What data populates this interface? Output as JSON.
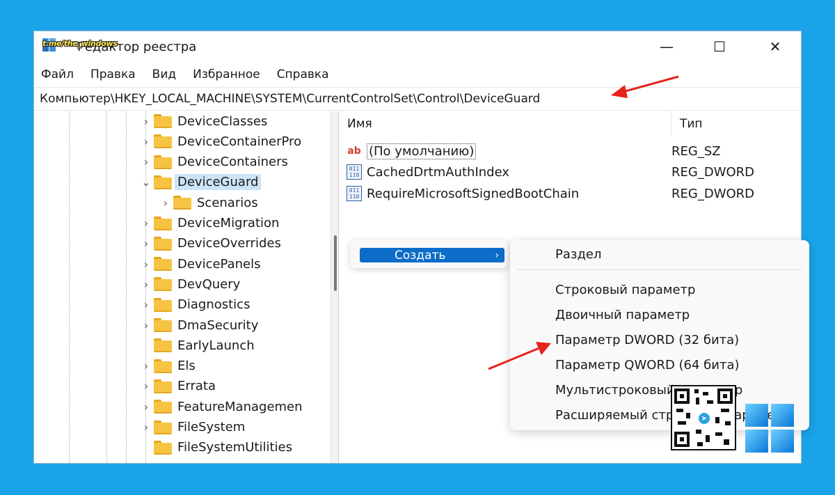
{
  "window": {
    "title": "Редактор реестра",
    "watermark": "t.me/the_windows",
    "controls": {
      "minimize": "—",
      "maximize": "☐",
      "close": "✕"
    }
  },
  "menu": [
    "Файл",
    "Правка",
    "Вид",
    "Избранное",
    "Справка"
  ],
  "address": "Компьютер\\HKEY_LOCAL_MACHINE\\SYSTEM\\CurrentControlSet\\Control\\DeviceGuard",
  "tree": [
    {
      "label": "DeviceClasses",
      "expander": "›"
    },
    {
      "label": "DeviceContainerPro",
      "expander": "›"
    },
    {
      "label": "DeviceContainers",
      "expander": "›"
    },
    {
      "label": "DeviceGuard",
      "expander": "⌄",
      "selected": true
    },
    {
      "label": "Scenarios",
      "expander": "›",
      "child": true
    },
    {
      "label": "DeviceMigration",
      "expander": "›"
    },
    {
      "label": "DeviceOverrides",
      "expander": "›"
    },
    {
      "label": "DevicePanels",
      "expander": "›"
    },
    {
      "label": "DevQuery",
      "expander": "›"
    },
    {
      "label": "Diagnostics",
      "expander": "›"
    },
    {
      "label": "DmaSecurity",
      "expander": "›"
    },
    {
      "label": "EarlyLaunch",
      "expander": ""
    },
    {
      "label": "Els",
      "expander": "›"
    },
    {
      "label": "Errata",
      "expander": "›"
    },
    {
      "label": "FeatureManagemen",
      "expander": "›"
    },
    {
      "label": "FileSystem",
      "expander": "›"
    },
    {
      "label": "FileSystemUtilities",
      "expander": ""
    }
  ],
  "values": {
    "headers": {
      "name": "Имя",
      "type": "Тип"
    },
    "rows": [
      {
        "icon": "string-value-icon",
        "name": "(По умолчанию)",
        "type": "REG_SZ"
      },
      {
        "icon": "binary-value-icon",
        "name": "CachedDrtmAuthIndex",
        "type": "REG_DWORD"
      },
      {
        "icon": "binary-value-icon",
        "name": "RequireMicrosoftSignedBootChain",
        "type": "REG_DWORD"
      }
    ]
  },
  "context_menu": {
    "item": "Создать",
    "arrow": "›"
  },
  "submenu": {
    "items": [
      "Раздел",
      "Строковый параметр",
      "Двоичный параметр",
      "Параметр DWORD (32 бита)",
      "Параметр QWORD (64 бита)",
      "Мультистроковый параметр",
      "Расширяемый строковый параметр"
    ]
  },
  "colors": {
    "background": "#1aa3e8",
    "selection": "#cce4f7",
    "menu_highlight": "#0b6cc9",
    "annotation_arrow": "#e5231b",
    "folder": "#f6c342"
  }
}
